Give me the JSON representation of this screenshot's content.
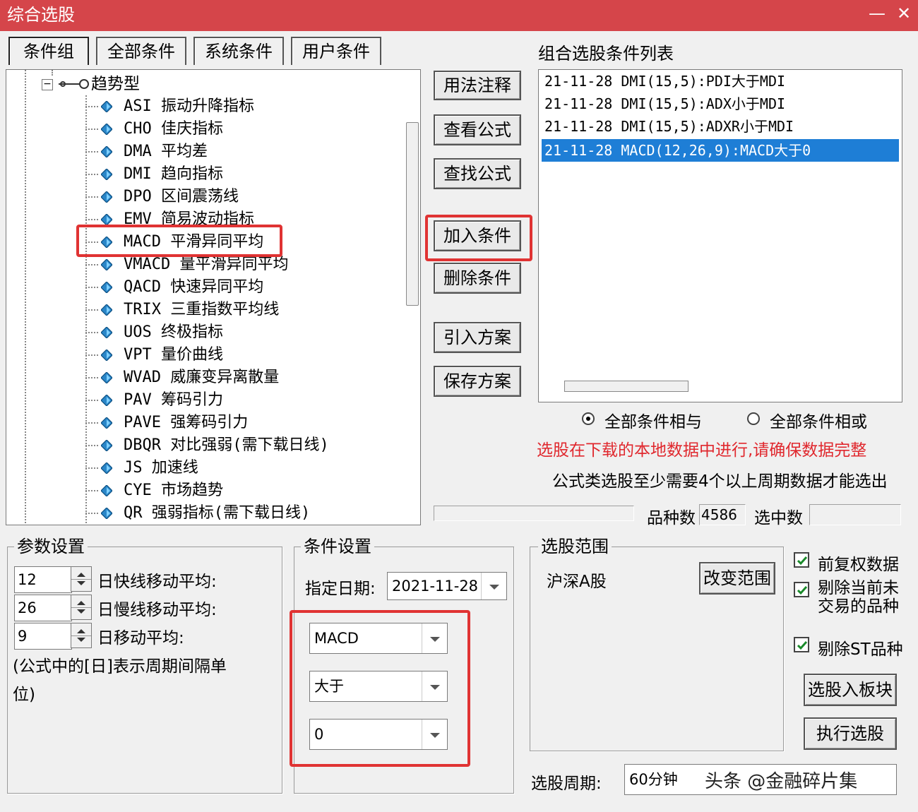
{
  "window": {
    "title": "综合选股",
    "minimize_icon": "minimize-icon",
    "close_icon": "close-icon"
  },
  "tabs": [
    {
      "label": "条件组"
    },
    {
      "label": "全部条件"
    },
    {
      "label": "系统条件"
    },
    {
      "label": "用户条件"
    }
  ],
  "tree": {
    "group_label": "趋势型",
    "items": [
      {
        "label": "ASI 振动升降指标"
      },
      {
        "label": "CHO 佳庆指标"
      },
      {
        "label": "DMA 平均差"
      },
      {
        "label": "DMI 趋向指标"
      },
      {
        "label": "DPO 区间震荡线"
      },
      {
        "label": "EMV 简易波动指标"
      },
      {
        "label": "MACD 平滑异同平均"
      },
      {
        "label": "VMACD 量平滑异同平均"
      },
      {
        "label": "QACD 快速异同平均"
      },
      {
        "label": "TRIX 三重指数平均线"
      },
      {
        "label": "UOS 终极指标"
      },
      {
        "label": "VPT 量价曲线"
      },
      {
        "label": "WVAD 威廉变异离散量"
      },
      {
        "label": "PAV 筹码引力"
      },
      {
        "label": "PAVE 强筹码引力"
      },
      {
        "label": "DBQR 对比强弱(需下载日线)"
      },
      {
        "label": "JS 加速线"
      },
      {
        "label": "CYE 市场趋势"
      },
      {
        "label": "QR 强弱指标(需下载日线)"
      }
    ]
  },
  "buttons": {
    "usage": "用法注释",
    "view_formula": "查看公式",
    "find_formula": "查找公式",
    "add_condition": "加入条件",
    "delete_condition": "删除条件",
    "import_plan": "引入方案",
    "save_plan": "保存方案",
    "change_range": "改变范围",
    "to_block": "选股入板块",
    "execute": "执行选股"
  },
  "condition_list": {
    "title": "组合选股条件列表",
    "rows": [
      {
        "text": "21-11-28 DMI(15,5):PDI大于MDI"
      },
      {
        "text": "21-11-28 DMI(15,5):ADX小于MDI"
      },
      {
        "text": "21-11-28 DMI(15,5):ADXR小于MDI"
      },
      {
        "text": "21-11-28 MACD(12,26,9):MACD大于0"
      }
    ],
    "selected_index": 3
  },
  "logic": {
    "and_label": "全部条件相与",
    "or_label": "全部条件相或",
    "selected": "and"
  },
  "notes": {
    "warning": "选股在下载的本地数据中进行,请确保数据完整",
    "info": "公式类选股至少需要4个以上周期数据才能选出"
  },
  "stats": {
    "count_label": "品种数",
    "count_value": "4586",
    "selected_label": "选中数",
    "selected_value": ""
  },
  "params": {
    "title": "参数设置",
    "rows": [
      {
        "value": "12",
        "label": "日快线移动平均:"
      },
      {
        "value": "26",
        "label": "日慢线移动平均:"
      },
      {
        "value": "9",
        "label": "日移动平均:"
      }
    ],
    "note_line1": "(公式中的[日]表示周期间隔单",
    "note_line2": "位)"
  },
  "condition": {
    "title": "条件设置",
    "date_label": "指定日期:",
    "date_value": "2021-11-28",
    "indicator": "MACD",
    "operator": "大于",
    "value": "0"
  },
  "range": {
    "title": "选股范围",
    "value": "沪深A股"
  },
  "options": [
    {
      "label": "前复权数据",
      "checked": true
    },
    {
      "label_line1": "剔除当前未",
      "label_line2": "交易的品种",
      "checked": true
    },
    {
      "label": "剔除ST品种",
      "checked": true
    }
  ],
  "period": {
    "label": "选股周期:",
    "value": "60分钟"
  },
  "watermark": "头条 @金融碎片集",
  "colors": {
    "titlebar": "#d5454a",
    "selection": "#1e7ed6",
    "highlight_box": "#e03333",
    "warning_text": "#e0282e"
  }
}
